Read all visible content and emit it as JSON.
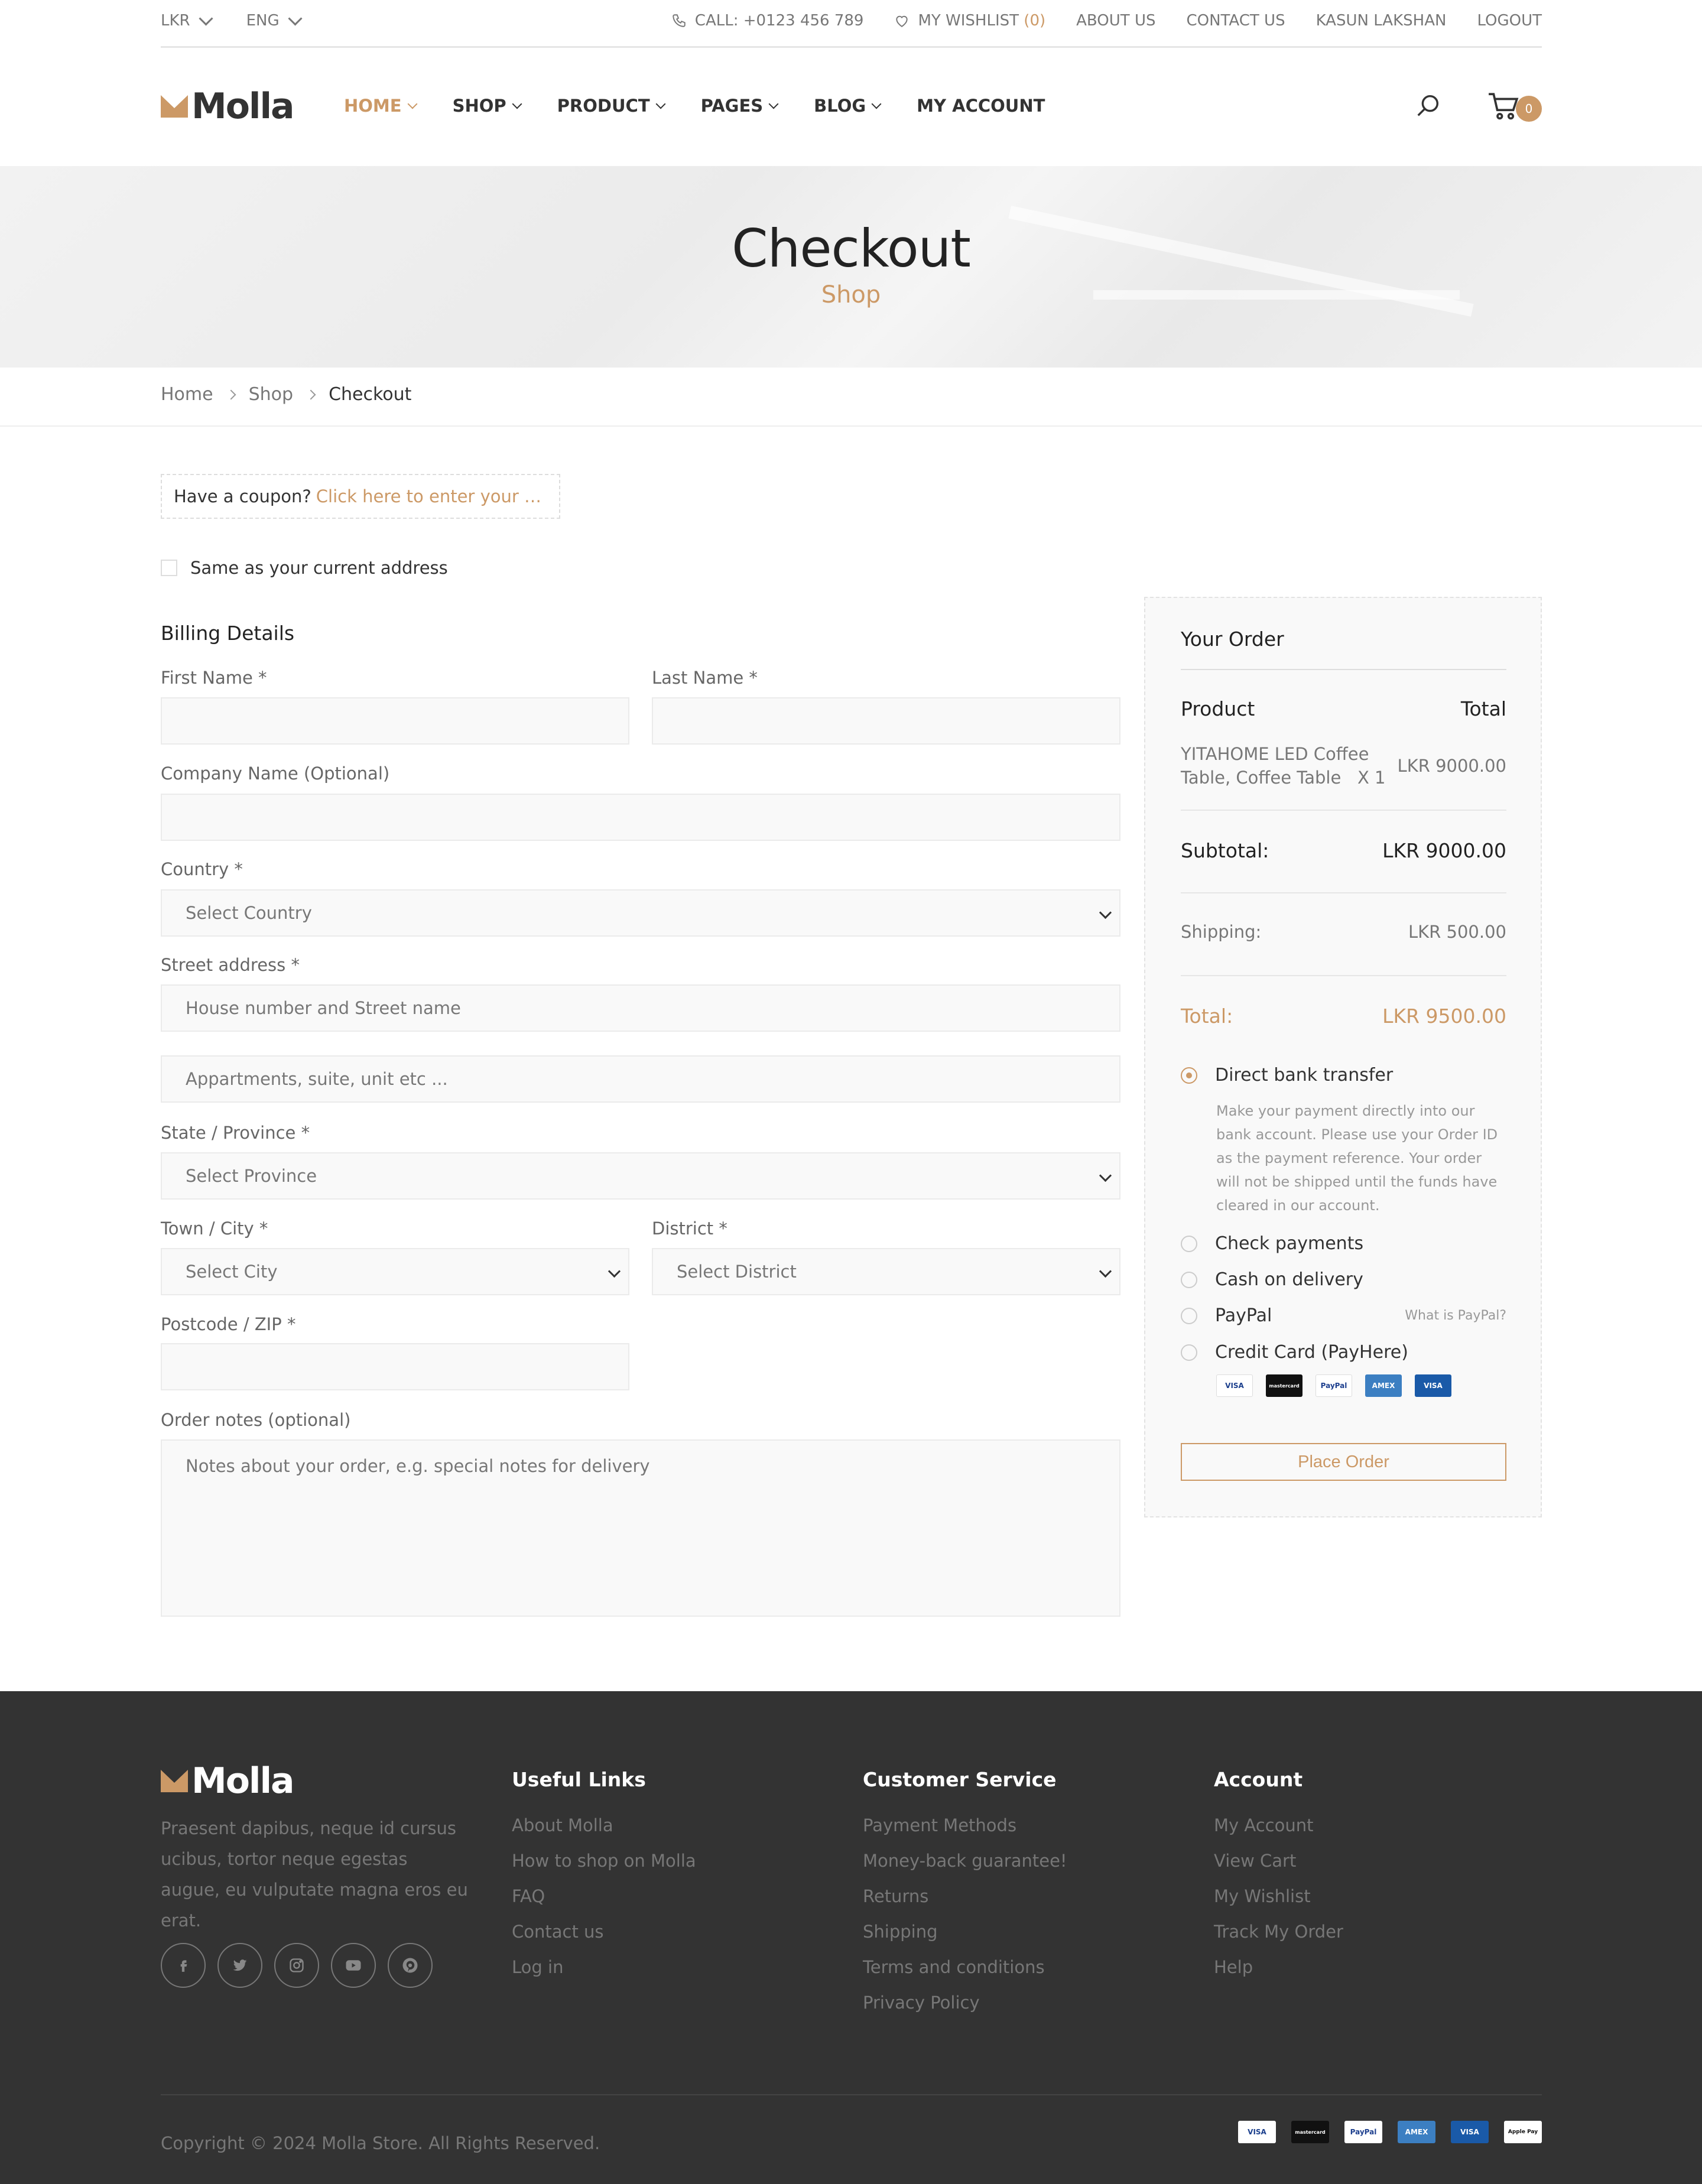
{
  "topbar": {
    "currency": "LKR",
    "language": "ENG",
    "call": "CALL: +0123 456 789",
    "wishlist_label": "MY WISHLIST",
    "wishlist_count": "(0)",
    "about": "ABOUT US",
    "contact": "CONTACT US",
    "user": "KASUN LAKSHAN",
    "logout": "LOGOUT"
  },
  "brand": {
    "name": "Molla",
    "accent_color": "#cc9966"
  },
  "nav": {
    "home": "HOME",
    "shop": "SHOP",
    "product": "PRODUCT",
    "pages": "PAGES",
    "blog": "BLOG",
    "account": "MY ACCOUNT"
  },
  "cart": {
    "count": "0"
  },
  "hero": {
    "title": "Checkout",
    "subtitle": "Shop"
  },
  "breadcrumb": [
    "Home",
    "Shop",
    "Checkout"
  ],
  "coupon": {
    "prompt": "Have a coupon?",
    "link": "Click here to enter your code"
  },
  "same_address": "Same as your current address",
  "billing": {
    "title": "Billing Details",
    "first_name": "First Name *",
    "last_name": "Last Name *",
    "company": "Company Name (Optional)",
    "country": "Country *",
    "country_placeholder": "Select Country",
    "street": "Street address *",
    "street_placeholder1": "House number and Street name",
    "street_placeholder2": "Appartments, suite, unit etc ...",
    "state": "State / Province *",
    "state_placeholder": "Select Province",
    "town": "Town / City *",
    "town_placeholder": "Select City",
    "district": "District *",
    "district_placeholder": "Select District",
    "postcode": "Postcode / ZIP *",
    "notes": "Order notes (optional)",
    "notes_placeholder": "Notes about your order, e.g. special notes for delivery"
  },
  "order": {
    "title": "Your Order",
    "col_product": "Product",
    "col_total": "Total",
    "item_name": "YITAHOME LED Coffee Table, Coffee Table",
    "item_qty": "X 1",
    "item_total": "LKR 9000.00",
    "subtotal_label": "Subtotal:",
    "subtotal": "LKR 9000.00",
    "shipping_label": "Shipping:",
    "shipping": "LKR 500.00",
    "total_label": "Total:",
    "total": "LKR 9500.00",
    "payments": {
      "bank": "Direct bank transfer",
      "bank_desc": "Make your payment directly into our bank account. Please use your Order ID as the payment reference. Your order will not be shipped until the funds have cleared in our account.",
      "check": "Check payments",
      "cod": "Cash on delivery",
      "paypal": "PayPal",
      "paypal_info": "What is PayPal?",
      "card": "Credit Card (PayHere)"
    },
    "card_icons": [
      "VISA",
      "mastercard",
      "PayPal",
      "AMEX",
      "VISA"
    ],
    "place_order": "Place Order"
  },
  "footer": {
    "about": "Praesent dapibus, neque id cursus ucibus, tortor neque egestas augue, eu vulputate magna eros eu erat.",
    "useful_title": "Useful Links",
    "useful": [
      "About Molla",
      "How to shop on Molla",
      "FAQ",
      "Contact us",
      "Log in"
    ],
    "service_title": "Customer Service",
    "service": [
      "Payment Methods",
      "Money-back guarantee!",
      "Returns",
      "Shipping",
      "Terms and conditions",
      "Privacy Policy"
    ],
    "account_title": "Account",
    "account": [
      "My Account",
      "View Cart",
      "My Wishlist",
      "Track My Order",
      "Help"
    ],
    "copyright": "Copyright © 2024 Molla Store. All Rights Reserved.",
    "card_icons": [
      "VISA",
      "mastercard",
      "PayPal",
      "AMEX",
      "VISA",
      "Apple Pay"
    ]
  }
}
